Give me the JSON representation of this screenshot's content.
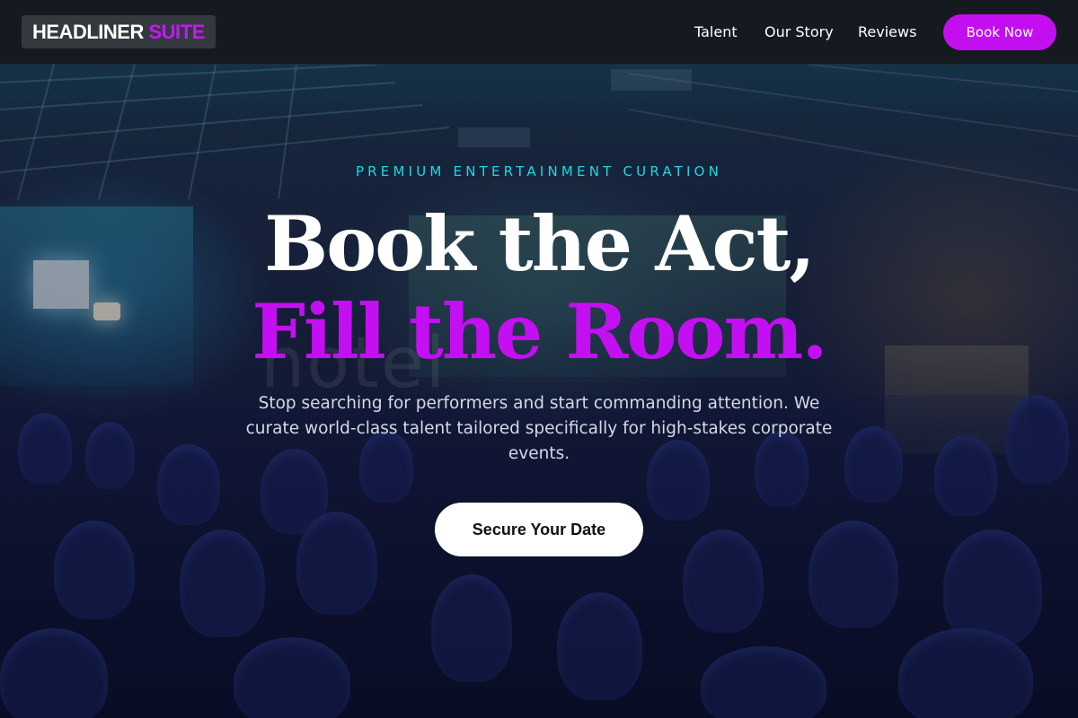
{
  "brand": {
    "name_part1": "HEADLINER",
    "name_part2": "SUITE",
    "accent_color": "#c319f2"
  },
  "nav": {
    "links": [
      {
        "label": "Talent"
      },
      {
        "label": "Our Story"
      },
      {
        "label": "Reviews"
      }
    ],
    "cta_label": "Book Now"
  },
  "hero": {
    "eyebrow": "PREMIUM ENTERTAINMENT CURATION",
    "headline_line1": "Book the Act,",
    "headline_line2": "Fill the Room.",
    "subtext": "Stop searching for performers and start commanding attention. We curate world-class talent tailored specifically for high-stakes corporate events.",
    "cta_label": "Secure Your Date",
    "background_image": "conference-audience-photo",
    "eyebrow_color": "#1ed6e6",
    "headline_accent_color": "#c40ff2"
  }
}
